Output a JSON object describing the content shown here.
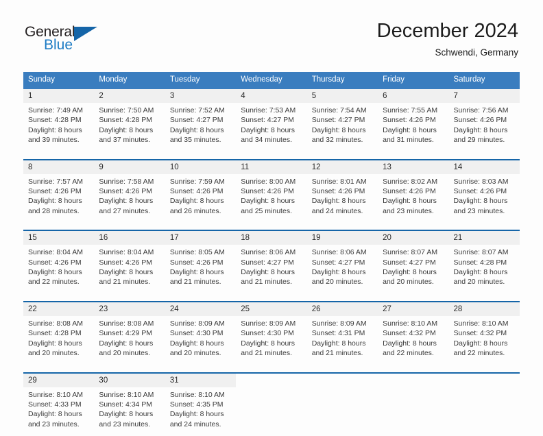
{
  "brand": {
    "name_top": "General",
    "name_bottom": "Blue",
    "triangle_color": "#1565a8",
    "blue_color": "#1d7cc4"
  },
  "header": {
    "title": "December 2024",
    "location": "Schwendi, Germany"
  },
  "theme": {
    "header_bg": "#3a7dbf",
    "week_separator": "#1565a8",
    "daynum_bg": "#f0f0f0",
    "page_bg": "#fdfdfd"
  },
  "weekdays": [
    "Sunday",
    "Monday",
    "Tuesday",
    "Wednesday",
    "Thursday",
    "Friday",
    "Saturday"
  ],
  "weeks": [
    [
      {
        "day": "1",
        "sunrise": "Sunrise: 7:49 AM",
        "sunset": "Sunset: 4:28 PM",
        "daylight1": "Daylight: 8 hours",
        "daylight2": "and 39 minutes."
      },
      {
        "day": "2",
        "sunrise": "Sunrise: 7:50 AM",
        "sunset": "Sunset: 4:28 PM",
        "daylight1": "Daylight: 8 hours",
        "daylight2": "and 37 minutes."
      },
      {
        "day": "3",
        "sunrise": "Sunrise: 7:52 AM",
        "sunset": "Sunset: 4:27 PM",
        "daylight1": "Daylight: 8 hours",
        "daylight2": "and 35 minutes."
      },
      {
        "day": "4",
        "sunrise": "Sunrise: 7:53 AM",
        "sunset": "Sunset: 4:27 PM",
        "daylight1": "Daylight: 8 hours",
        "daylight2": "and 34 minutes."
      },
      {
        "day": "5",
        "sunrise": "Sunrise: 7:54 AM",
        "sunset": "Sunset: 4:27 PM",
        "daylight1": "Daylight: 8 hours",
        "daylight2": "and 32 minutes."
      },
      {
        "day": "6",
        "sunrise": "Sunrise: 7:55 AM",
        "sunset": "Sunset: 4:26 PM",
        "daylight1": "Daylight: 8 hours",
        "daylight2": "and 31 minutes."
      },
      {
        "day": "7",
        "sunrise": "Sunrise: 7:56 AM",
        "sunset": "Sunset: 4:26 PM",
        "daylight1": "Daylight: 8 hours",
        "daylight2": "and 29 minutes."
      }
    ],
    [
      {
        "day": "8",
        "sunrise": "Sunrise: 7:57 AM",
        "sunset": "Sunset: 4:26 PM",
        "daylight1": "Daylight: 8 hours",
        "daylight2": "and 28 minutes."
      },
      {
        "day": "9",
        "sunrise": "Sunrise: 7:58 AM",
        "sunset": "Sunset: 4:26 PM",
        "daylight1": "Daylight: 8 hours",
        "daylight2": "and 27 minutes."
      },
      {
        "day": "10",
        "sunrise": "Sunrise: 7:59 AM",
        "sunset": "Sunset: 4:26 PM",
        "daylight1": "Daylight: 8 hours",
        "daylight2": "and 26 minutes."
      },
      {
        "day": "11",
        "sunrise": "Sunrise: 8:00 AM",
        "sunset": "Sunset: 4:26 PM",
        "daylight1": "Daylight: 8 hours",
        "daylight2": "and 25 minutes."
      },
      {
        "day": "12",
        "sunrise": "Sunrise: 8:01 AM",
        "sunset": "Sunset: 4:26 PM",
        "daylight1": "Daylight: 8 hours",
        "daylight2": "and 24 minutes."
      },
      {
        "day": "13",
        "sunrise": "Sunrise: 8:02 AM",
        "sunset": "Sunset: 4:26 PM",
        "daylight1": "Daylight: 8 hours",
        "daylight2": "and 23 minutes."
      },
      {
        "day": "14",
        "sunrise": "Sunrise: 8:03 AM",
        "sunset": "Sunset: 4:26 PM",
        "daylight1": "Daylight: 8 hours",
        "daylight2": "and 23 minutes."
      }
    ],
    [
      {
        "day": "15",
        "sunrise": "Sunrise: 8:04 AM",
        "sunset": "Sunset: 4:26 PM",
        "daylight1": "Daylight: 8 hours",
        "daylight2": "and 22 minutes."
      },
      {
        "day": "16",
        "sunrise": "Sunrise: 8:04 AM",
        "sunset": "Sunset: 4:26 PM",
        "daylight1": "Daylight: 8 hours",
        "daylight2": "and 21 minutes."
      },
      {
        "day": "17",
        "sunrise": "Sunrise: 8:05 AM",
        "sunset": "Sunset: 4:26 PM",
        "daylight1": "Daylight: 8 hours",
        "daylight2": "and 21 minutes."
      },
      {
        "day": "18",
        "sunrise": "Sunrise: 8:06 AM",
        "sunset": "Sunset: 4:27 PM",
        "daylight1": "Daylight: 8 hours",
        "daylight2": "and 21 minutes."
      },
      {
        "day": "19",
        "sunrise": "Sunrise: 8:06 AM",
        "sunset": "Sunset: 4:27 PM",
        "daylight1": "Daylight: 8 hours",
        "daylight2": "and 20 minutes."
      },
      {
        "day": "20",
        "sunrise": "Sunrise: 8:07 AM",
        "sunset": "Sunset: 4:27 PM",
        "daylight1": "Daylight: 8 hours",
        "daylight2": "and 20 minutes."
      },
      {
        "day": "21",
        "sunrise": "Sunrise: 8:07 AM",
        "sunset": "Sunset: 4:28 PM",
        "daylight1": "Daylight: 8 hours",
        "daylight2": "and 20 minutes."
      }
    ],
    [
      {
        "day": "22",
        "sunrise": "Sunrise: 8:08 AM",
        "sunset": "Sunset: 4:28 PM",
        "daylight1": "Daylight: 8 hours",
        "daylight2": "and 20 minutes."
      },
      {
        "day": "23",
        "sunrise": "Sunrise: 8:08 AM",
        "sunset": "Sunset: 4:29 PM",
        "daylight1": "Daylight: 8 hours",
        "daylight2": "and 20 minutes."
      },
      {
        "day": "24",
        "sunrise": "Sunrise: 8:09 AM",
        "sunset": "Sunset: 4:30 PM",
        "daylight1": "Daylight: 8 hours",
        "daylight2": "and 20 minutes."
      },
      {
        "day": "25",
        "sunrise": "Sunrise: 8:09 AM",
        "sunset": "Sunset: 4:30 PM",
        "daylight1": "Daylight: 8 hours",
        "daylight2": "and 21 minutes."
      },
      {
        "day": "26",
        "sunrise": "Sunrise: 8:09 AM",
        "sunset": "Sunset: 4:31 PM",
        "daylight1": "Daylight: 8 hours",
        "daylight2": "and 21 minutes."
      },
      {
        "day": "27",
        "sunrise": "Sunrise: 8:10 AM",
        "sunset": "Sunset: 4:32 PM",
        "daylight1": "Daylight: 8 hours",
        "daylight2": "and 22 minutes."
      },
      {
        "day": "28",
        "sunrise": "Sunrise: 8:10 AM",
        "sunset": "Sunset: 4:32 PM",
        "daylight1": "Daylight: 8 hours",
        "daylight2": "and 22 minutes."
      }
    ],
    [
      {
        "day": "29",
        "sunrise": "Sunrise: 8:10 AM",
        "sunset": "Sunset: 4:33 PM",
        "daylight1": "Daylight: 8 hours",
        "daylight2": "and 23 minutes."
      },
      {
        "day": "30",
        "sunrise": "Sunrise: 8:10 AM",
        "sunset": "Sunset: 4:34 PM",
        "daylight1": "Daylight: 8 hours",
        "daylight2": "and 23 minutes."
      },
      {
        "day": "31",
        "sunrise": "Sunrise: 8:10 AM",
        "sunset": "Sunset: 4:35 PM",
        "daylight1": "Daylight: 8 hours",
        "daylight2": "and 24 minutes."
      },
      {
        "day": "",
        "sunrise": "",
        "sunset": "",
        "daylight1": "",
        "daylight2": ""
      },
      {
        "day": "",
        "sunrise": "",
        "sunset": "",
        "daylight1": "",
        "daylight2": ""
      },
      {
        "day": "",
        "sunrise": "",
        "sunset": "",
        "daylight1": "",
        "daylight2": ""
      },
      {
        "day": "",
        "sunrise": "",
        "sunset": "",
        "daylight1": "",
        "daylight2": ""
      }
    ]
  ]
}
